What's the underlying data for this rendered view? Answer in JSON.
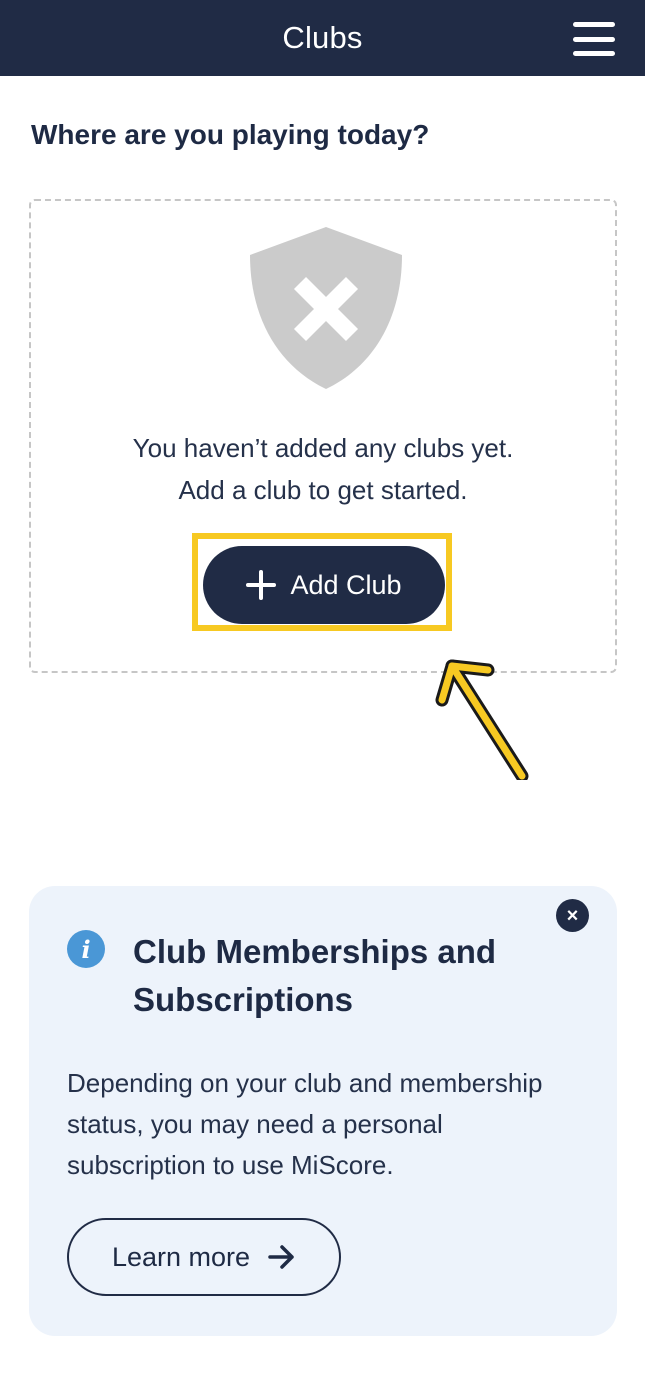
{
  "header": {
    "title": "Clubs",
    "menu_icon": "hamburger-menu-icon"
  },
  "main": {
    "heading": "Where are you playing today?",
    "empty_state": {
      "icon": "shield-x-icon",
      "line1": "You haven’t added any clubs yet.",
      "line2": "Add a club to get started.",
      "add_button_label": "Add Club",
      "add_button_icon": "plus-icon"
    }
  },
  "info_card": {
    "icon": "info-icon",
    "close_icon": "close-icon",
    "close_glyph": "×",
    "info_glyph": "i",
    "title": "Club Memberships and Subscriptions",
    "body": "Depending on your club and membership status, you may need a personal subscription to use MiScore.",
    "learn_more_label": "Learn more",
    "learn_more_icon": "arrow-right-icon"
  },
  "colors": {
    "header_bg": "#202b45",
    "info_card_bg": "#edf3fb",
    "info_icon": "#4a97d6",
    "highlight": "#f7c922",
    "shield": "#cbcbcb"
  }
}
